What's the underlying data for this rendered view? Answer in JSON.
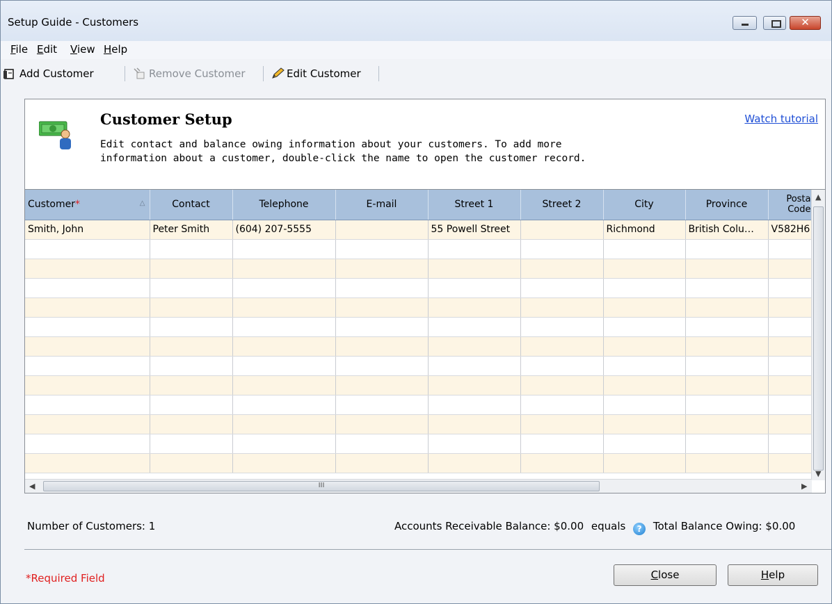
{
  "window": {
    "title": "Setup Guide - Customers",
    "close_glyph": "✕"
  },
  "menu": [
    {
      "key": "F",
      "rest": "ile"
    },
    {
      "key": "E",
      "rest": "dit"
    },
    {
      "key": "V",
      "rest": "iew"
    },
    {
      "key": "H",
      "rest": "elp"
    }
  ],
  "toolbar": {
    "add_label": "Add Customer",
    "remove_label": "Remove Customer",
    "edit_label": "Edit Customer"
  },
  "header": {
    "title": "Customer Setup",
    "description": "Edit contact and balance owing information about your customers. To add more information about a customer, double-click the name to open the customer record.",
    "tutorial_link": "Watch tutorial"
  },
  "grid": {
    "columns": [
      "Customer",
      "Contact",
      "Telephone",
      "E-mail",
      "Street 1",
      "Street 2",
      "City",
      "Province",
      "Posta Code"
    ],
    "required_marker": "*",
    "rows": [
      [
        "Smith, John",
        "Peter Smith",
        "(604) 207-5555",
        "",
        "55 Powell Street",
        "",
        "Richmond",
        "British Colu…",
        "V582H6"
      ]
    ],
    "scroll_ellipsis": "III"
  },
  "footer": {
    "count_label": "Number of Customers: 1",
    "ar_balance": "Accounts Receivable Balance: $0.00",
    "equals": "equals",
    "total_balance": "Total Balance Owing: $0.00",
    "required_note": "*Required Field",
    "close_key": "C",
    "close_rest": "lose",
    "help_key": "H",
    "help_rest": "elp"
  },
  "colors": {
    "header_bg": "#a8c0dc",
    "stripe": "#fdf5e4",
    "required": "#e02020",
    "link": "#1f4fd6"
  }
}
